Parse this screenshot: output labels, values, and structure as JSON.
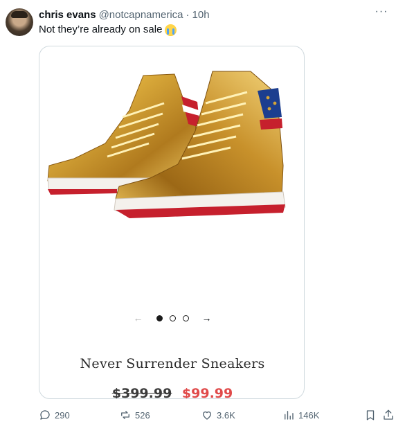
{
  "tweet": {
    "author_name": "chris evans",
    "handle": "@notcapnamerica",
    "separator": "·",
    "time": "10h",
    "more_label": "···",
    "text": "Not they’re already on sale",
    "emoji": "loudly-crying-face"
  },
  "media": {
    "product_name": "Never Surrender Sneakers",
    "old_price": "$399.99",
    "new_price": "$99.99",
    "carousel": {
      "prev_arrow": "←",
      "next_arrow": "→",
      "dots": [
        "active",
        "inactive",
        "inactive"
      ]
    },
    "colors": {
      "gold": "#d4a437",
      "red_stripe": "#c6202d",
      "blue_panel": "#1c3e8f",
      "sale_price": "#e04a4a"
    }
  },
  "actions": {
    "replies": "290",
    "reposts": "526",
    "likes": "3.6K",
    "views": "146K"
  }
}
